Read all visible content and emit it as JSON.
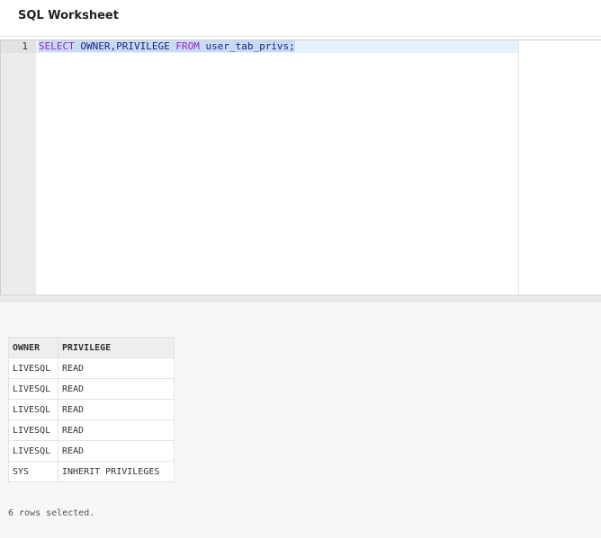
{
  "header": {
    "title": "SQL Worksheet"
  },
  "editor": {
    "line_number": "1",
    "code": {
      "kw_select": "SELECT",
      "columns": " OWNER,PRIVILEGE ",
      "kw_from": "FROM",
      "table": " user_tab_privs;"
    }
  },
  "results": {
    "columns": [
      "OWNER",
      "PRIVILEGE"
    ],
    "rows": [
      [
        "LIVESQL",
        "READ"
      ],
      [
        "LIVESQL",
        "READ"
      ],
      [
        "LIVESQL",
        "READ"
      ],
      [
        "LIVESQL",
        "READ"
      ],
      [
        "LIVESQL",
        "READ"
      ],
      [
        "SYS",
        "INHERIT PRIVILEGES"
      ]
    ],
    "status": "6 rows selected."
  }
}
